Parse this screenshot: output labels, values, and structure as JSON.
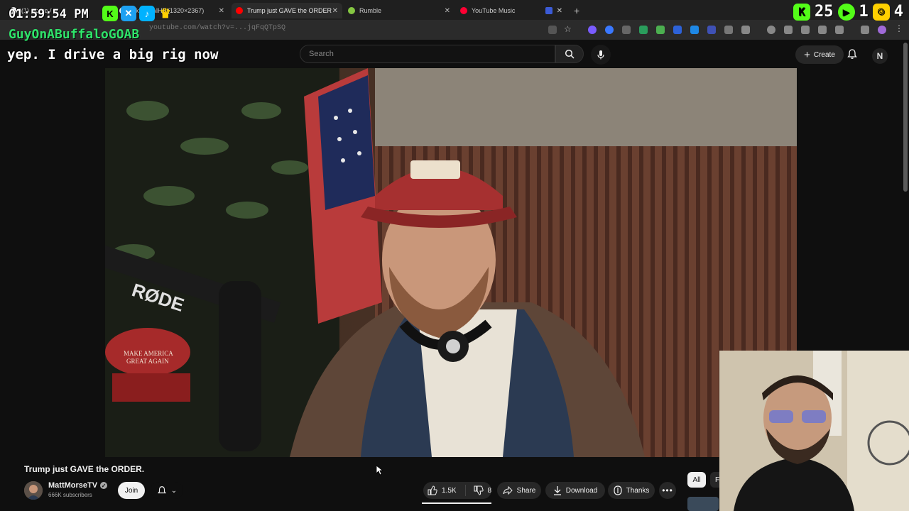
{
  "browser": {
    "tabs": [
      {
        "title": "(1) Home / X",
        "favicon_color": "#e8e8e8"
      },
      {
        "title": "GkN...cAlH5 (1320×2367)",
        "favicon_color": "#e8e8e8"
      },
      {
        "title": "Trump just GAVE the ORDER",
        "favicon_color": "#ff0000",
        "active": true
      },
      {
        "title": "Rumble",
        "favicon_color": "#85c742"
      },
      {
        "title": "YouTube Music",
        "favicon_color": "#ff0033"
      }
    ],
    "url": "youtube.com/watch?v=...jqFqQTpSQ"
  },
  "overlay": {
    "time": "01:59:54 PM",
    "username": "GuyOnABuffaloGOAB",
    "message": "yep. I drive a big rig now",
    "counter_left": "25",
    "counter_mid": "1",
    "counter_right": "4"
  },
  "header": {
    "search_placeholder": "Search",
    "create_label": "Create",
    "avatar_letter": "N"
  },
  "video": {
    "title": "Trump just GAVE the ORDER.",
    "mic_brand": "RØDE",
    "hat_text": "MAKE AMERICA GREAT AGAIN"
  },
  "channel": {
    "name": "MattMorseTV",
    "subscribers": "666K subscribers",
    "join_label": "Join"
  },
  "actions": {
    "likes": "1.5K",
    "dislikes": "8",
    "share": "Share",
    "download": "Download",
    "thanks": "Thanks"
  },
  "chips": [
    "All",
    "F"
  ],
  "colors": {
    "accent_red": "#ff0000",
    "overlay_green": "#2fe36a",
    "background": "#0f0f0f"
  }
}
